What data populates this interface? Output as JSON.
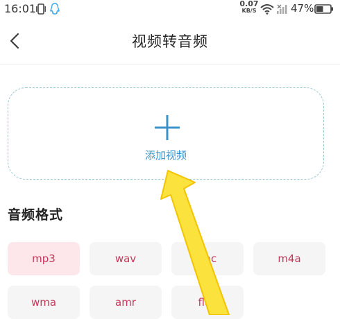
{
  "status_bar": {
    "time": "16:01",
    "net_speed_value": "0.07",
    "net_speed_unit": "KB/S",
    "battery_percent": "47%",
    "icons": [
      "vibrate-icon",
      "qq-icon",
      "wifi-icon",
      "signal-icon",
      "battery-icon"
    ]
  },
  "header": {
    "title": "视频转音频",
    "back_icon": "chevron-left-icon"
  },
  "add_video": {
    "label": "添加视频",
    "icon": "plus-icon"
  },
  "audio_format": {
    "title": "音频格式",
    "selected": "mp3",
    "options": [
      "mp3",
      "wav",
      "aac",
      "m4a",
      "wma",
      "amr",
      "flac"
    ]
  },
  "overlay": {
    "annotation": "yellow-arrow-icon"
  },
  "colors": {
    "accent_blue": "#3a93c9",
    "format_text": "#c5375a",
    "format_selected_bg": "#fde7ea",
    "format_bg": "#f5f5f5",
    "dashed_border": "#9cc7cf",
    "arrow": "#fbe23c"
  }
}
